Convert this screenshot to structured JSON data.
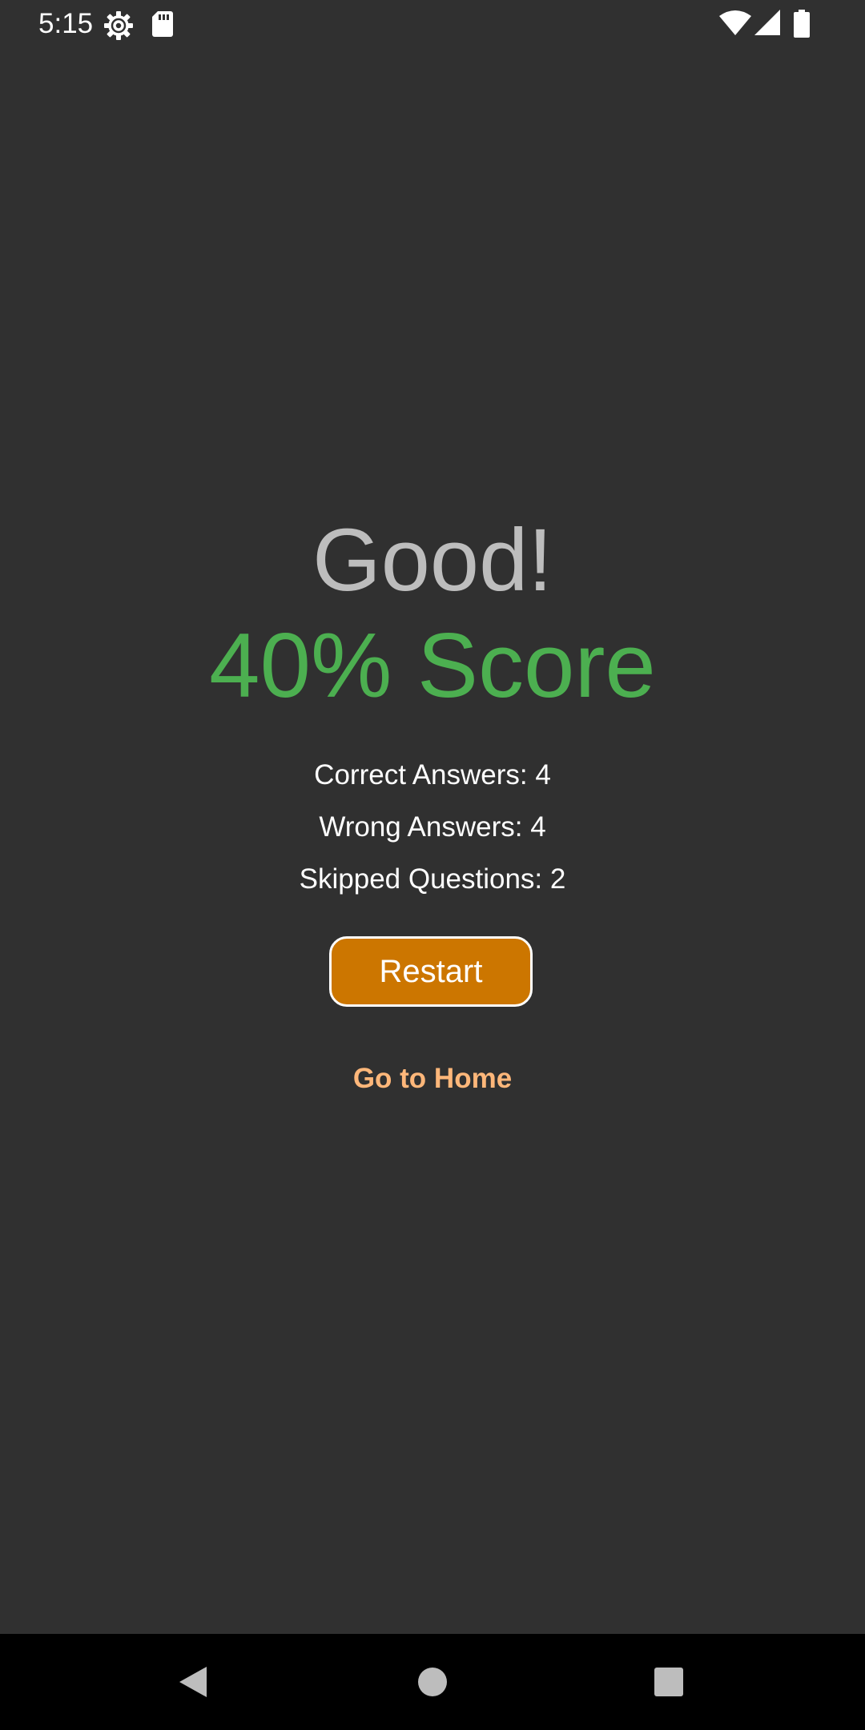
{
  "status_bar": {
    "time": "5:15",
    "icons": [
      "settings-gear-icon",
      "sd-card-icon",
      "wifi-icon",
      "cellular-signal-icon",
      "battery-icon"
    ]
  },
  "result": {
    "verdict": "Good!",
    "score_text": "40% Score",
    "score_color": "#4caf50",
    "verdict_color": "#bdbdbd"
  },
  "stats": {
    "correct": "Correct Answers: 4",
    "wrong": "Wrong Answers: 4",
    "skipped": "Skipped Questions: 2"
  },
  "actions": {
    "restart_label": "Restart",
    "restart_color": "#cc7600",
    "home_label": "Go to Home",
    "home_color": "#ffb77a"
  },
  "nav_bar": {
    "icons": [
      "back-icon",
      "home-icon",
      "recents-icon"
    ]
  }
}
